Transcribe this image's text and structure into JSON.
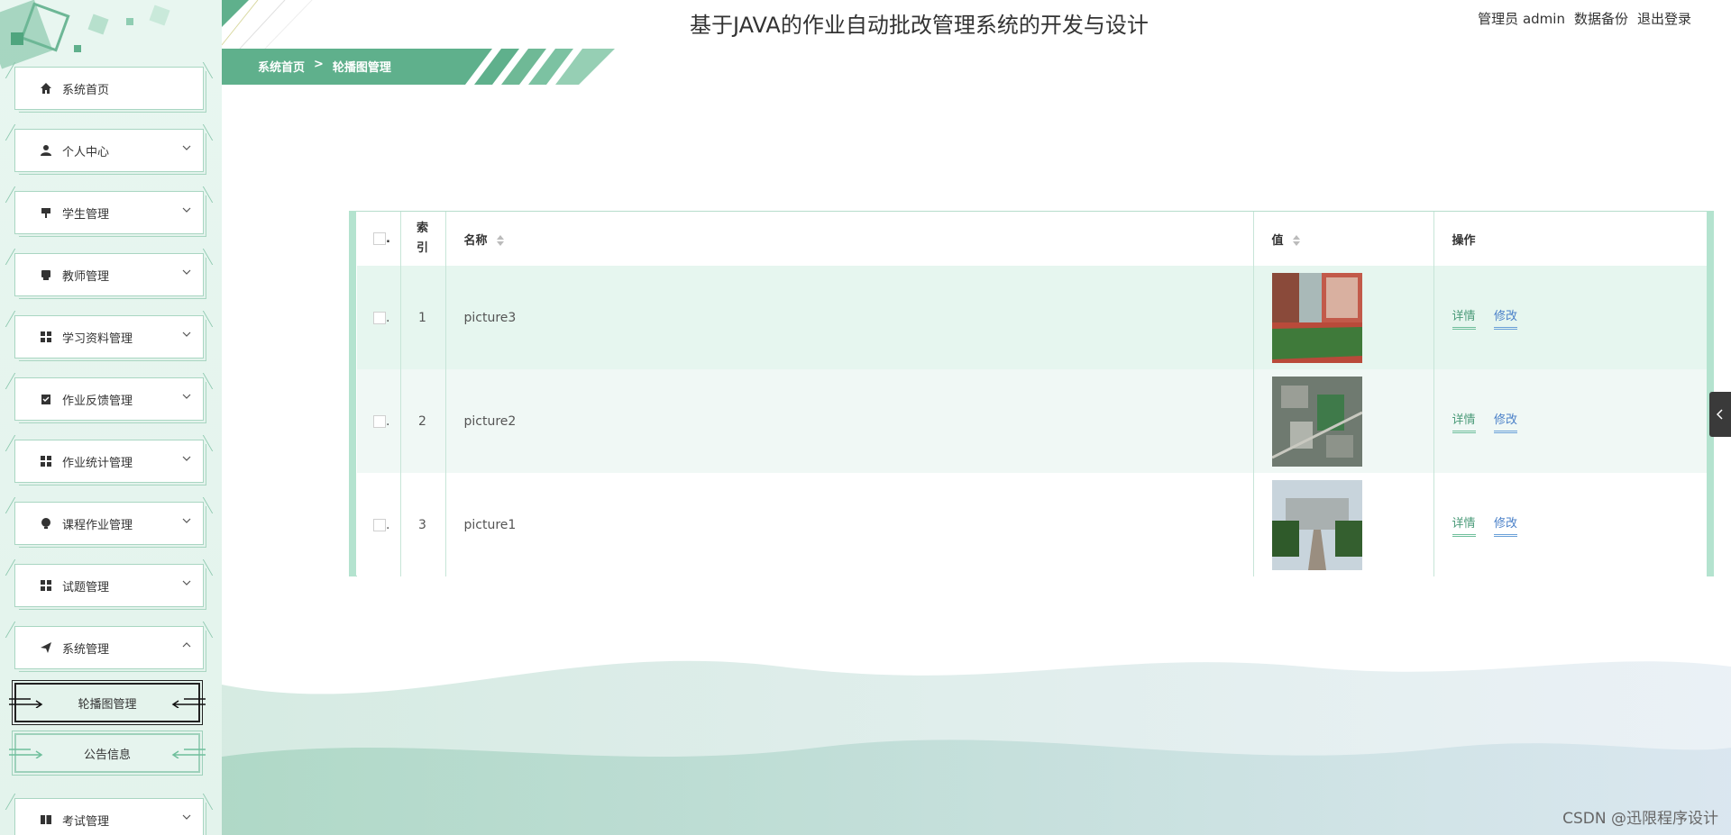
{
  "header": {
    "title": "基于JAVA的作业自动批改管理系统的开发与设计",
    "role": "管理员",
    "username": "admin",
    "backup": "数据备份",
    "logout": "退出登录"
  },
  "breadcrumb": {
    "home": "系统首页",
    "separator": ">",
    "current": "轮播图管理"
  },
  "sidebar": {
    "items": [
      {
        "label": "系统首页",
        "icon": "home-icon"
      },
      {
        "label": "个人中心",
        "icon": "user-icon"
      },
      {
        "label": "学生管理",
        "icon": "student-icon"
      },
      {
        "label": "教师管理",
        "icon": "teacher-icon"
      },
      {
        "label": "学习资料管理",
        "icon": "grid-icon"
      },
      {
        "label": "作业反馈管理",
        "icon": "clipboard-icon"
      },
      {
        "label": "作业统计管理",
        "icon": "grid-icon"
      },
      {
        "label": "课程作业管理",
        "icon": "bulb-icon"
      },
      {
        "label": "试题管理",
        "icon": "grid-icon"
      },
      {
        "label": "系统管理",
        "icon": "send-icon"
      },
      {
        "label": "考试管理",
        "icon": "book-icon"
      }
    ],
    "sub_items": [
      {
        "label": "轮播图管理"
      },
      {
        "label": "公告信息"
      }
    ]
  },
  "table": {
    "headers": {
      "check": ".",
      "index": "索引",
      "name": "名称",
      "value": "值",
      "ops": "操作"
    },
    "rows": [
      {
        "check": ".",
        "index": "1",
        "name": "picture3",
        "thumb": "campus-building-track",
        "detail": "详情",
        "edit": "修改"
      },
      {
        "check": ".",
        "index": "2",
        "name": "picture2",
        "thumb": "campus-aerial-view",
        "detail": "详情",
        "edit": "修改"
      },
      {
        "check": ".",
        "index": "3",
        "name": "picture1",
        "thumb": "campus-main-gate",
        "detail": "详情",
        "edit": "修改"
      }
    ]
  },
  "watermark": "CSDN @迅限程序设计",
  "colors": {
    "accent": "#5fb08c",
    "sidebar_bg": "#e6f4ee",
    "row1": "#e6f6ef",
    "row2": "#f0f8f5",
    "detail_link": "#4a9a78",
    "edit_link": "#4a80c8"
  }
}
